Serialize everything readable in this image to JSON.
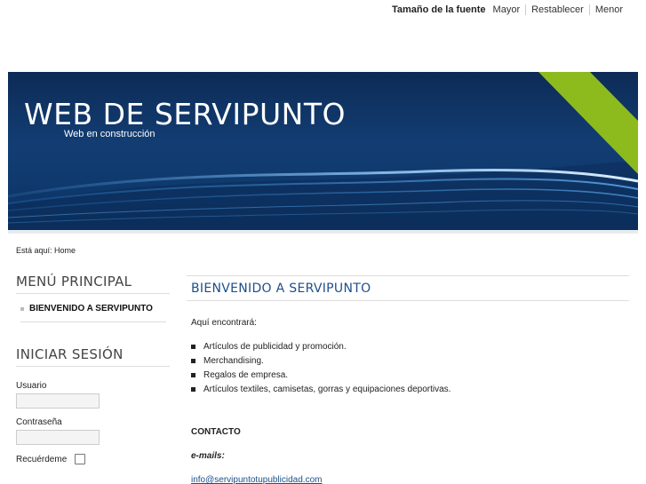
{
  "font_size_bar": {
    "label": "Tamaño de la fuente",
    "bigger": "Mayor",
    "reset": "Restablecer",
    "smaller": "Menor"
  },
  "header": {
    "site_title": "WEB DE SERVIPUNTO",
    "subtitle": "Web en construcción"
  },
  "breadcrumb": "Está aquí: Home",
  "main_menu": {
    "title": "MENÚ PRINCIPAL",
    "items": [
      {
        "label": "BIENVENIDO A SERVIPUNTO"
      }
    ]
  },
  "login": {
    "title": "INICIAR SESIÓN",
    "username_label": "Usuario",
    "password_label": "Contraseña",
    "remember_label": "Recuérdeme"
  },
  "article": {
    "title": "BIENVENIDO A SERVIPUNTO",
    "intro": "Aquí encontrará:",
    "items": [
      "Artículos de publicidad y promoción.",
      "Merchandising.",
      "Regalos de empresa.",
      "Artículos textiles, camisetas, gorras y equipaciones deportivas."
    ],
    "contact_heading": "CONTACTO",
    "emails_label": "e-mails:",
    "email": "info@servipuntotupublicidad.com"
  },
  "colors": {
    "banner_dark": "#0d2b56",
    "accent_green": "#8dbb1e",
    "title_blue": "#1d4f8a"
  }
}
